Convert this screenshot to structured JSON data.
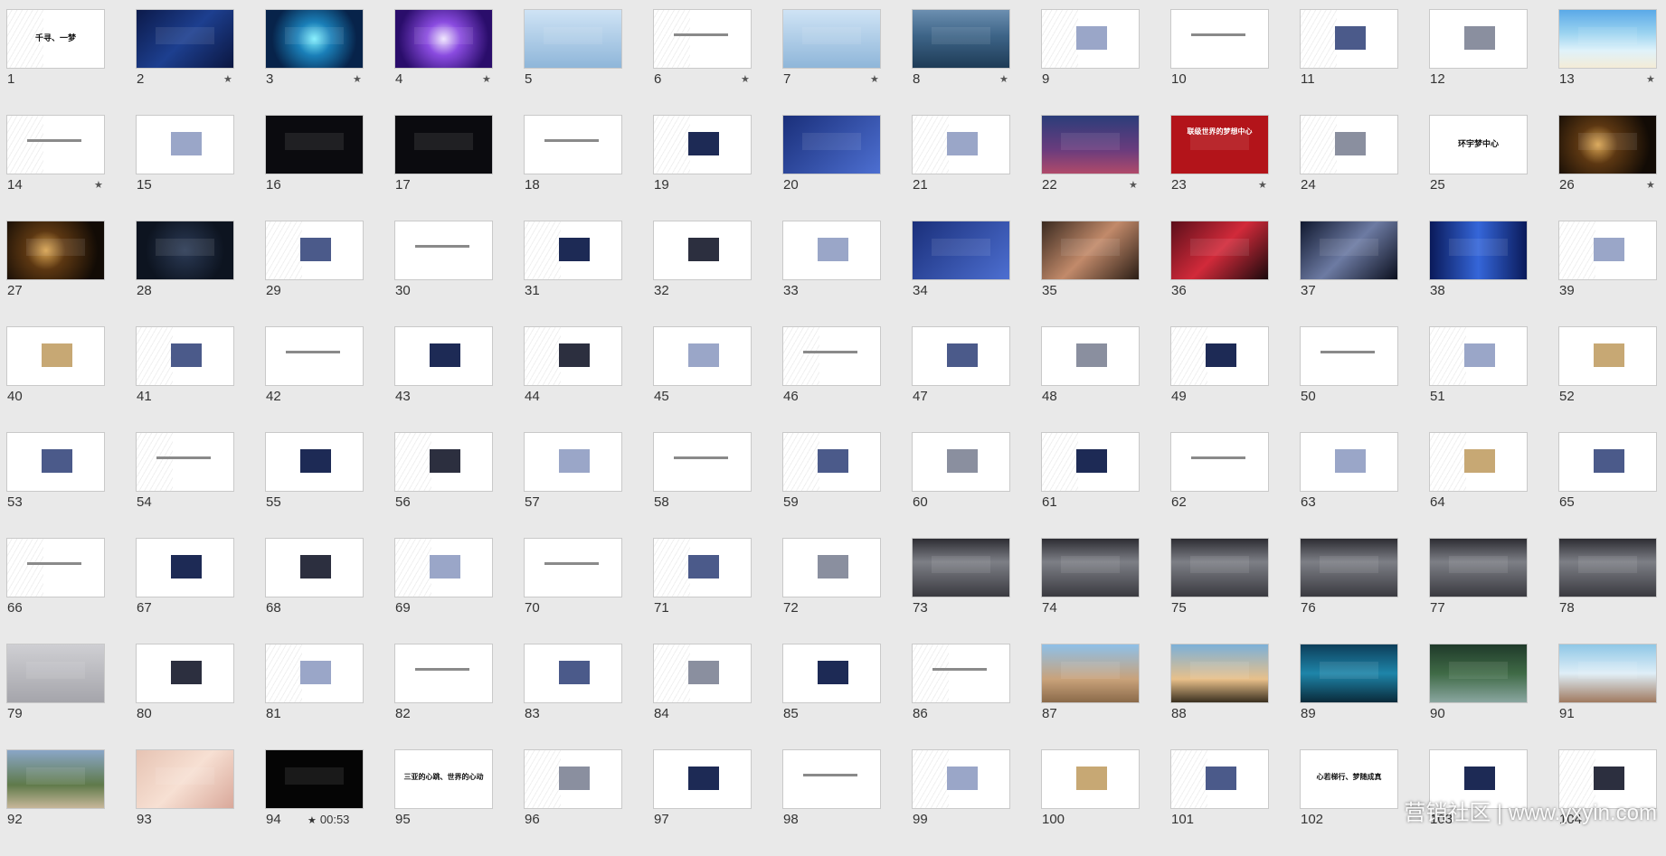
{
  "slides": [
    {
      "n": "1",
      "star": false,
      "theme": "white",
      "title": "千寻、一梦"
    },
    {
      "n": "2",
      "star": true,
      "theme": "navy"
    },
    {
      "n": "3",
      "star": true,
      "theme": "cyan"
    },
    {
      "n": "4",
      "star": true,
      "theme": "purple"
    },
    {
      "n": "5",
      "star": false,
      "theme": "sky"
    },
    {
      "n": "6",
      "star": true,
      "theme": "white"
    },
    {
      "n": "7",
      "star": true,
      "theme": "sky"
    },
    {
      "n": "8",
      "star": true,
      "theme": "ocean"
    },
    {
      "n": "9",
      "star": false,
      "theme": "white"
    },
    {
      "n": "10",
      "star": false,
      "theme": "white"
    },
    {
      "n": "11",
      "star": false,
      "theme": "white"
    },
    {
      "n": "12",
      "star": false,
      "theme": "white"
    },
    {
      "n": "13",
      "star": true,
      "theme": "beach"
    },
    {
      "n": "14",
      "star": true,
      "theme": "white"
    },
    {
      "n": "15",
      "star": false,
      "theme": "white"
    },
    {
      "n": "16",
      "star": false,
      "theme": "dark"
    },
    {
      "n": "17",
      "star": false,
      "theme": "dark"
    },
    {
      "n": "18",
      "star": false,
      "theme": "white"
    },
    {
      "n": "19",
      "star": false,
      "theme": "white"
    },
    {
      "n": "20",
      "star": false,
      "theme": "blue"
    },
    {
      "n": "21",
      "star": false,
      "theme": "white"
    },
    {
      "n": "22",
      "star": true,
      "theme": "city"
    },
    {
      "n": "23",
      "star": true,
      "theme": "red",
      "title": "联级世界的梦想中心"
    },
    {
      "n": "24",
      "star": false,
      "theme": "white"
    },
    {
      "n": "25",
      "star": false,
      "theme": "white",
      "title": "环宇梦中心"
    },
    {
      "n": "26",
      "star": true,
      "theme": "night"
    },
    {
      "n": "27",
      "star": false,
      "theme": "night"
    },
    {
      "n": "28",
      "star": false,
      "theme": "space"
    },
    {
      "n": "29",
      "star": false,
      "theme": "white"
    },
    {
      "n": "30",
      "star": false,
      "theme": "white"
    },
    {
      "n": "31",
      "star": false,
      "theme": "white"
    },
    {
      "n": "32",
      "star": false,
      "theme": "white"
    },
    {
      "n": "33",
      "star": false,
      "theme": "white"
    },
    {
      "n": "34",
      "star": false,
      "theme": "blue"
    },
    {
      "n": "35",
      "star": false,
      "theme": "photo1"
    },
    {
      "n": "36",
      "star": false,
      "theme": "photo2"
    },
    {
      "n": "37",
      "star": false,
      "theme": "photo3"
    },
    {
      "n": "38",
      "star": false,
      "theme": "photo4"
    },
    {
      "n": "39",
      "star": false,
      "theme": "white"
    },
    {
      "n": "40",
      "star": false,
      "theme": "white"
    },
    {
      "n": "41",
      "star": false,
      "theme": "white"
    },
    {
      "n": "42",
      "star": false,
      "theme": "white"
    },
    {
      "n": "43",
      "star": false,
      "theme": "white"
    },
    {
      "n": "44",
      "star": false,
      "theme": "white"
    },
    {
      "n": "45",
      "star": false,
      "theme": "white"
    },
    {
      "n": "46",
      "star": false,
      "theme": "white"
    },
    {
      "n": "47",
      "star": false,
      "theme": "white"
    },
    {
      "n": "48",
      "star": false,
      "theme": "white"
    },
    {
      "n": "49",
      "star": false,
      "theme": "white"
    },
    {
      "n": "50",
      "star": false,
      "theme": "white"
    },
    {
      "n": "51",
      "star": false,
      "theme": "white"
    },
    {
      "n": "52",
      "star": false,
      "theme": "white"
    },
    {
      "n": "53",
      "star": false,
      "theme": "white"
    },
    {
      "n": "54",
      "star": false,
      "theme": "white"
    },
    {
      "n": "55",
      "star": false,
      "theme": "white"
    },
    {
      "n": "56",
      "star": false,
      "theme": "white"
    },
    {
      "n": "57",
      "star": false,
      "theme": "white"
    },
    {
      "n": "58",
      "star": false,
      "theme": "white"
    },
    {
      "n": "59",
      "star": false,
      "theme": "white"
    },
    {
      "n": "60",
      "star": false,
      "theme": "white"
    },
    {
      "n": "61",
      "star": false,
      "theme": "white"
    },
    {
      "n": "62",
      "star": false,
      "theme": "white"
    },
    {
      "n": "63",
      "star": false,
      "theme": "white"
    },
    {
      "n": "64",
      "star": false,
      "theme": "white"
    },
    {
      "n": "65",
      "star": false,
      "theme": "white"
    },
    {
      "n": "66",
      "star": false,
      "theme": "white"
    },
    {
      "n": "67",
      "star": false,
      "theme": "white"
    },
    {
      "n": "68",
      "star": false,
      "theme": "white"
    },
    {
      "n": "69",
      "star": false,
      "theme": "white"
    },
    {
      "n": "70",
      "star": false,
      "theme": "white"
    },
    {
      "n": "71",
      "star": false,
      "theme": "white"
    },
    {
      "n": "72",
      "star": false,
      "theme": "white"
    },
    {
      "n": "73",
      "star": false,
      "theme": "station"
    },
    {
      "n": "74",
      "star": false,
      "theme": "station"
    },
    {
      "n": "75",
      "star": false,
      "theme": "station"
    },
    {
      "n": "76",
      "star": false,
      "theme": "station"
    },
    {
      "n": "77",
      "star": false,
      "theme": "station"
    },
    {
      "n": "78",
      "star": false,
      "theme": "station"
    },
    {
      "n": "79",
      "star": false,
      "theme": "grey"
    },
    {
      "n": "80",
      "star": false,
      "theme": "white"
    },
    {
      "n": "81",
      "star": false,
      "theme": "white"
    },
    {
      "n": "82",
      "star": false,
      "theme": "white"
    },
    {
      "n": "83",
      "star": false,
      "theme": "white"
    },
    {
      "n": "84",
      "star": false,
      "theme": "white"
    },
    {
      "n": "85",
      "star": false,
      "theme": "white"
    },
    {
      "n": "86",
      "star": false,
      "theme": "white"
    },
    {
      "n": "87",
      "star": false,
      "theme": "kids"
    },
    {
      "n": "88",
      "star": false,
      "theme": "sunset"
    },
    {
      "n": "89",
      "star": false,
      "theme": "sea2"
    },
    {
      "n": "90",
      "star": false,
      "theme": "forest"
    },
    {
      "n": "91",
      "star": false,
      "theme": "spa"
    },
    {
      "n": "92",
      "star": false,
      "theme": "park"
    },
    {
      "n": "93",
      "star": false,
      "theme": "girl"
    },
    {
      "n": "94",
      "star": true,
      "theme": "black",
      "timing": "00:53"
    },
    {
      "n": "95",
      "star": false,
      "theme": "white",
      "title": "三亚的心跳、世界的心动"
    },
    {
      "n": "96",
      "star": false,
      "theme": "white"
    },
    {
      "n": "97",
      "star": false,
      "theme": "white"
    },
    {
      "n": "98",
      "star": false,
      "theme": "white"
    },
    {
      "n": "99",
      "star": false,
      "theme": "white"
    },
    {
      "n": "100",
      "star": false,
      "theme": "white"
    },
    {
      "n": "101",
      "star": false,
      "theme": "white"
    },
    {
      "n": "102",
      "star": false,
      "theme": "white",
      "title": "心若梯行、梦随成真"
    },
    {
      "n": "103",
      "star": false,
      "theme": "white"
    },
    {
      "n": "104",
      "star": false,
      "theme": "white"
    }
  ],
  "star_glyph": "★",
  "watermark": "营销社区 | www.yxyin.com"
}
